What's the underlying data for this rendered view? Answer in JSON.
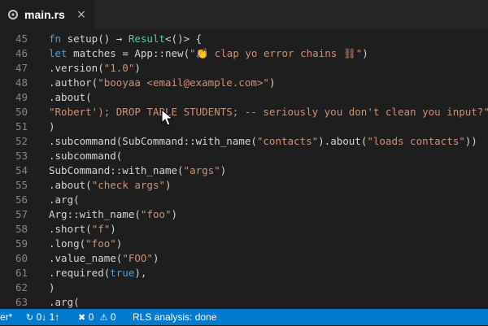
{
  "tab": {
    "title": "main.rs",
    "close_glyph": "×"
  },
  "editor": {
    "lines": [
      {
        "n": "45",
        "segs": [
          [
            "fn ",
            "kw"
          ],
          [
            "setup() ",
            "pl"
          ],
          [
            "→ ",
            "pl"
          ],
          [
            "Result",
            "ty"
          ],
          [
            "<()> {",
            "pl"
          ]
        ]
      },
      {
        "n": "46",
        "segs": [
          [
            "let ",
            "kw"
          ],
          [
            "matches = App::new(",
            "pl"
          ],
          [
            "\"",
            "st"
          ],
          [
            "👏",
            "pl"
          ],
          [
            " clap yo error chains ⛓\"",
            "st"
          ],
          [
            ")",
            "pl"
          ]
        ]
      },
      {
        "n": "47",
        "segs": [
          [
            ".version(",
            "pl"
          ],
          [
            "\"1.0\"",
            "st"
          ],
          [
            ")",
            "pl"
          ]
        ]
      },
      {
        "n": "48",
        "segs": [
          [
            ".author(",
            "pl"
          ],
          [
            "\"booyaa <email@example.com>\"",
            "st"
          ],
          [
            ")",
            "pl"
          ]
        ]
      },
      {
        "n": "49",
        "segs": [
          [
            ".about(",
            "pl"
          ]
        ]
      },
      {
        "n": "50",
        "segs": [
          [
            "\"Robert'); DROP TABLE STUDENTS; -- seriously you don't clean you input?\"",
            "st"
          ],
          [
            ",",
            "pl"
          ]
        ]
      },
      {
        "n": "51",
        "segs": [
          [
            ")",
            "pl"
          ]
        ]
      },
      {
        "n": "52",
        "segs": [
          [
            ".subcommand(SubCommand::with_name(",
            "pl"
          ],
          [
            "\"contacts\"",
            "st"
          ],
          [
            ").about(",
            "pl"
          ],
          [
            "\"loads contacts\"",
            "st"
          ],
          [
            "))",
            "pl"
          ]
        ]
      },
      {
        "n": "53",
        "segs": [
          [
            ".subcommand(",
            "pl"
          ]
        ]
      },
      {
        "n": "54",
        "segs": [
          [
            "SubCommand::with_name(",
            "pl"
          ],
          [
            "\"args\"",
            "st"
          ],
          [
            ")",
            "pl"
          ]
        ]
      },
      {
        "n": "55",
        "segs": [
          [
            ".about(",
            "pl"
          ],
          [
            "\"check args\"",
            "st"
          ],
          [
            ")",
            "pl"
          ]
        ]
      },
      {
        "n": "56",
        "segs": [
          [
            ".arg(",
            "pl"
          ]
        ]
      },
      {
        "n": "57",
        "segs": [
          [
            "Arg::with_name(",
            "pl"
          ],
          [
            "\"foo\"",
            "st"
          ],
          [
            ")",
            "pl"
          ]
        ]
      },
      {
        "n": "58",
        "segs": [
          [
            ".short(",
            "pl"
          ],
          [
            "\"f\"",
            "st"
          ],
          [
            ")",
            "pl"
          ]
        ]
      },
      {
        "n": "59",
        "segs": [
          [
            ".long(",
            "pl"
          ],
          [
            "\"foo\"",
            "st"
          ],
          [
            ")",
            "pl"
          ]
        ]
      },
      {
        "n": "60",
        "segs": [
          [
            ".value_name(",
            "pl"
          ],
          [
            "\"FOO\"",
            "st"
          ],
          [
            ")",
            "pl"
          ]
        ]
      },
      {
        "n": "61",
        "segs": [
          [
            ".required(",
            "pl"
          ],
          [
            "true",
            "kw"
          ],
          [
            "),",
            "pl"
          ]
        ]
      },
      {
        "n": "62",
        "segs": [
          [
            ")",
            "pl"
          ]
        ]
      },
      {
        "n": "63",
        "segs": [
          [
            ".arg(",
            "pl"
          ]
        ]
      }
    ]
  },
  "statusbar": {
    "branch": "er*",
    "sync_icon": "↻",
    "sync": "0↓ 1↑",
    "errors_icon": "✖",
    "errors": "0",
    "warnings_icon": "⚠",
    "warnings": "0",
    "rls": "RLS analysis: done"
  },
  "icons": {
    "file": "rust-file-icon",
    "cursor": "mouse-pointer-icon"
  },
  "colors": {
    "background": "#1e1e1e",
    "tabbar": "#252526",
    "statusbar": "#007acc",
    "keyword": "#569cd6",
    "type": "#4ec9b0",
    "string": "#ce9178",
    "line_number": "#858585"
  }
}
